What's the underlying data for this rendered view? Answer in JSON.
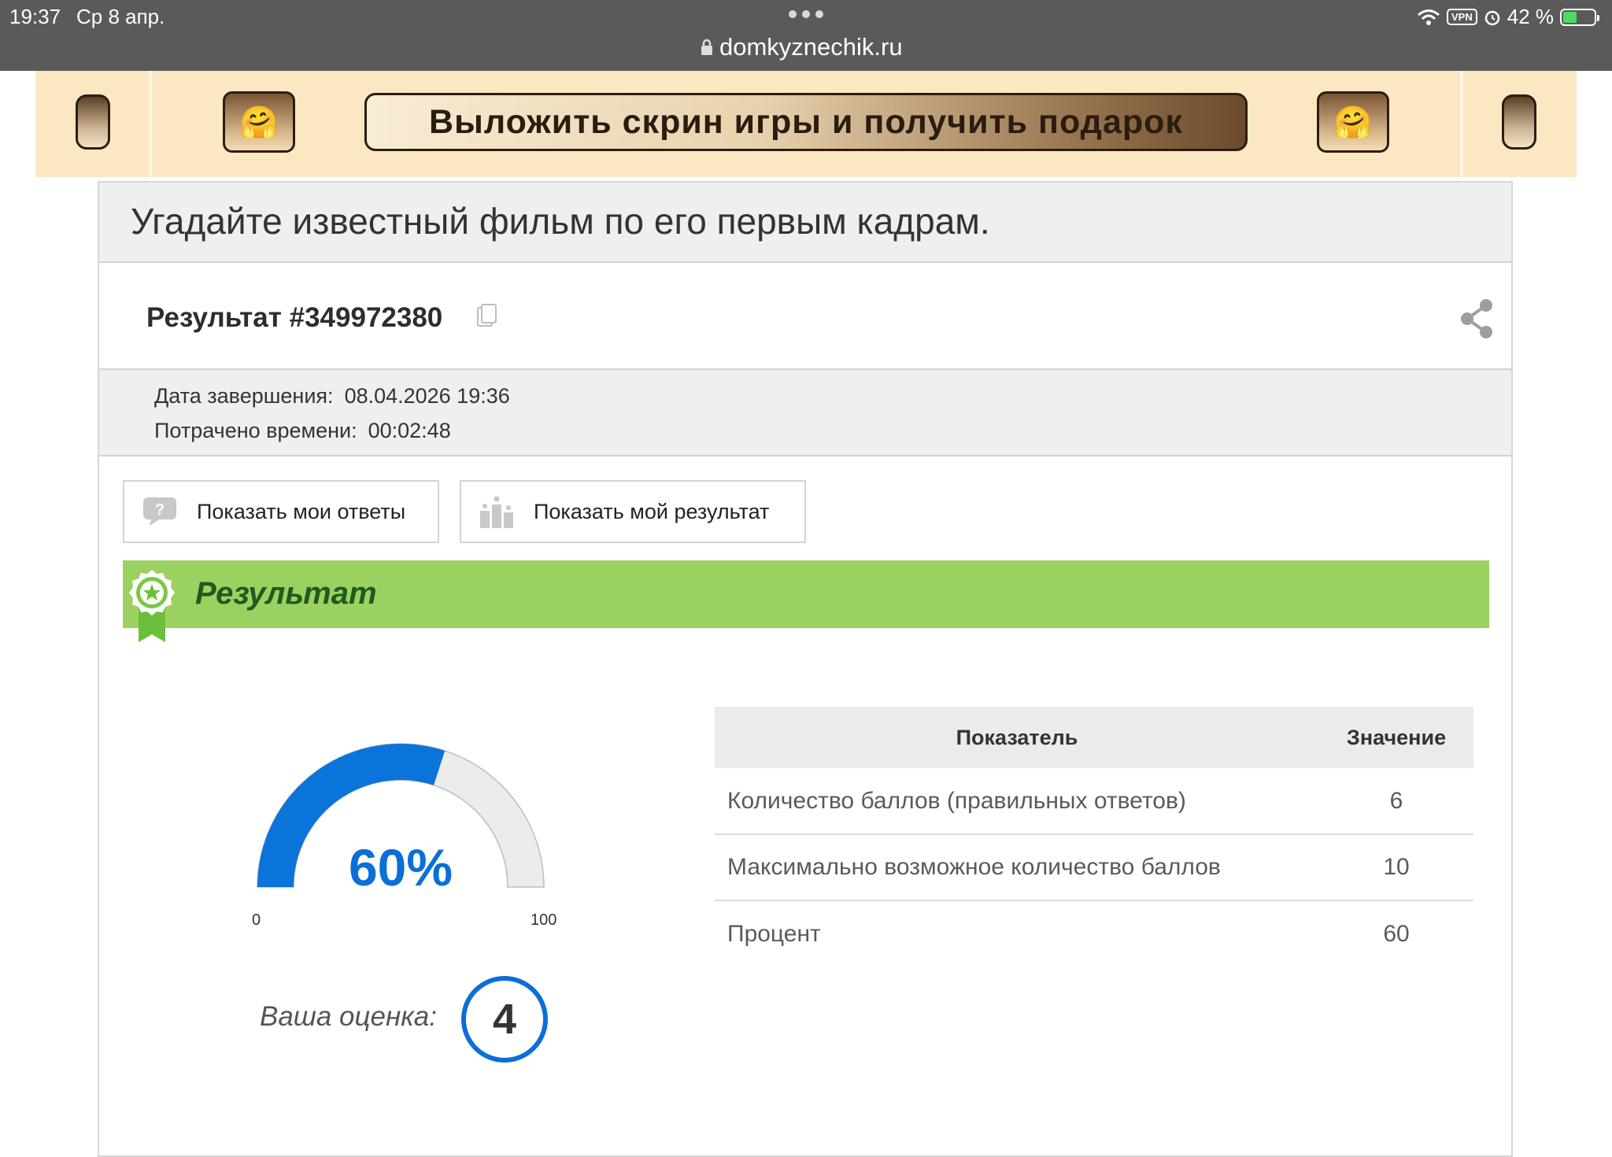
{
  "status_bar": {
    "time": "19:37",
    "date": "Ср 8 апр.",
    "url": "domkyznechik.ru",
    "vpn": "VPN",
    "battery": "42 %"
  },
  "promo": {
    "text": "Выложить скрин игры и получить подарок",
    "emoji": "🤗"
  },
  "page": {
    "title": "Угадайте известный фильм по его первым кадрам."
  },
  "result": {
    "label": "Результат #349972380",
    "completed_label": "Дата завершения:",
    "completed_value": "08.04.2026 19:36",
    "time_label": "Потрачено времени:",
    "time_value": "00:02:48"
  },
  "buttons": {
    "show_answers": "Показать мои ответы",
    "show_result": "Показать мой результат"
  },
  "result_section": {
    "title": "Результат"
  },
  "gauge": {
    "percent": 60,
    "percent_label": "60%",
    "min": "0",
    "max": "100"
  },
  "grade": {
    "label": "Ваша оценка:",
    "value": "4"
  },
  "stats_table": {
    "headers": [
      "Показатель",
      "Значение"
    ],
    "rows": [
      {
        "label": "Количество баллов (правильных ответов)",
        "value": "6"
      },
      {
        "label": "Максимально возможное количество баллов",
        "value": "10"
      },
      {
        "label": "Процент",
        "value": "60"
      }
    ]
  },
  "colors": {
    "status_bar": "#5a5a5a",
    "promo_bg": "#fbe8c3",
    "result_banner": "#9bd160",
    "gauge_fill": "#0a74da",
    "gauge_track": "#ececec",
    "accent": "#0a6fd6"
  }
}
